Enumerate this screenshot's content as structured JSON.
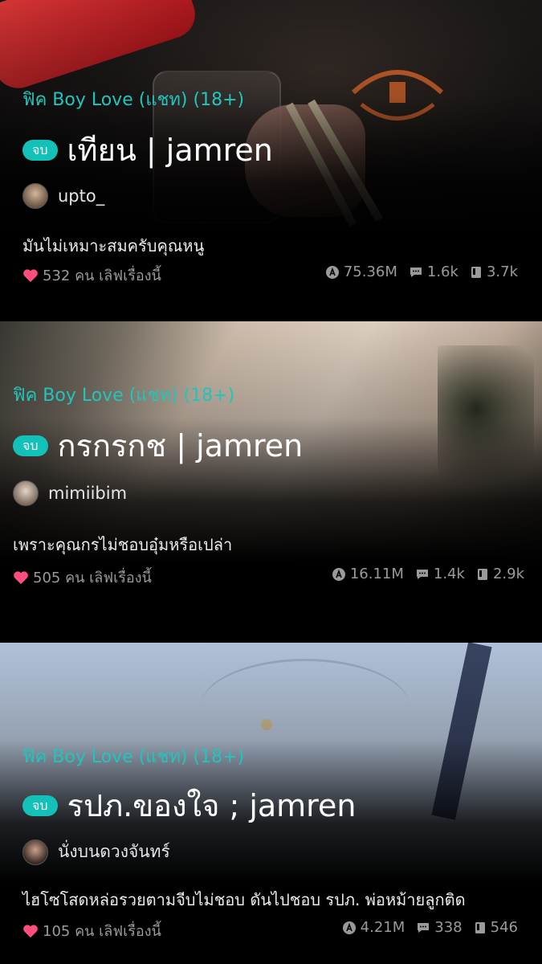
{
  "stories": [
    {
      "genre": "ฟิค Boy Love (แชท) (18+)",
      "badge": "จบ",
      "title": "เทียน | jamren",
      "author": "upto_",
      "description": "มันไม่เหมาะสมครับคุณหนู",
      "likes": "532 คน เลิฟเรื่องนี้",
      "views": "75.36M",
      "comments": "1.6k",
      "chapters": "3.7k"
    },
    {
      "genre": "ฟิค Boy Love (แชท) (18+)",
      "badge": "จบ",
      "title": "กรกรกช | jamren",
      "author": "mimiibim",
      "description": "เพราะคุณกรไม่ชอบอุ๋มหรือเปล่า",
      "likes": "505 คน เลิฟเรื่องนี้",
      "views": "16.11M",
      "comments": "1.4k",
      "chapters": "2.9k"
    },
    {
      "genre": "ฟิค Boy Love (แชท) (18+)",
      "badge": "จบ",
      "title": "รปภ.ของใจ ; jamren",
      "author": "นั่งบนดวงจันทร์",
      "description": "ไฮโซโสดหล่อรวยตามจีบไม่ชอบ ดันไปชอบ รปภ. พ่อหม้ายลูกติด",
      "likes": "105 คน เลิฟเรื่องนี้",
      "views": "4.21M",
      "comments": "338",
      "chapters": "546"
    }
  ],
  "icons": {
    "heart": "heart-icon",
    "views": "view-count-icon",
    "comments": "comment-icon",
    "chapters": "chapter-icon"
  },
  "colors": {
    "accent": "#20c5bd",
    "heart": "#ff4d7e",
    "meta": "#9a9a9a"
  }
}
